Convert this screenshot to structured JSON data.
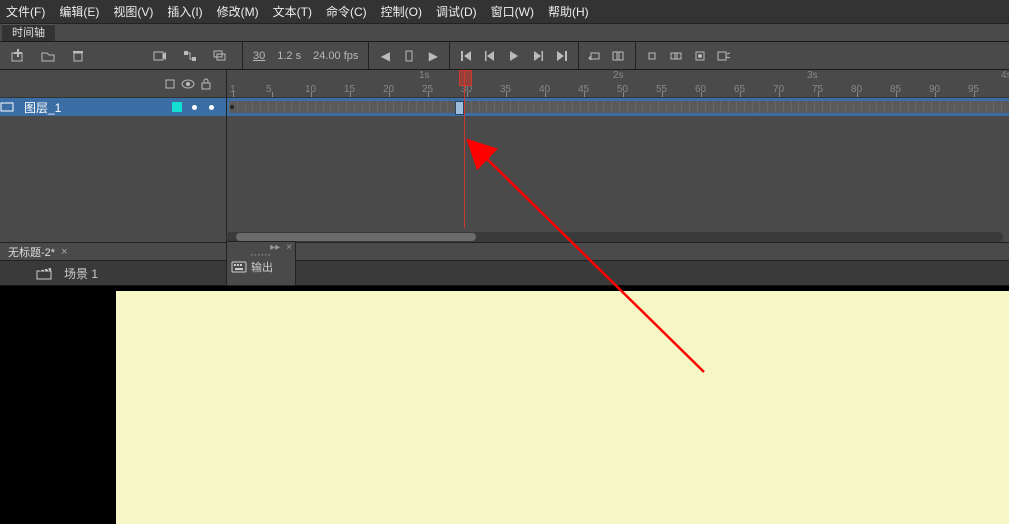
{
  "menu": [
    "文件(F)",
    "编辑(E)",
    "视图(V)",
    "插入(I)",
    "修改(M)",
    "文本(T)",
    "命令(C)",
    "控制(O)",
    "调试(D)",
    "窗口(W)",
    "帮助(H)"
  ],
  "panel_tab": "时间轴",
  "toolbar": {
    "frame_label": "30",
    "time_label": "1.2 s",
    "fps_label": "24.00 fps"
  },
  "ruler": {
    "seconds": [
      "1s",
      "2s",
      "3s",
      "4s"
    ],
    "frames": [
      "1",
      "5",
      "10",
      "15",
      "20",
      "25",
      "30",
      "35",
      "40",
      "45",
      "50",
      "55",
      "60",
      "65",
      "70",
      "75",
      "80",
      "85",
      "90",
      "95"
    ]
  },
  "layer": {
    "name": "图层_1"
  },
  "doc_tab": "无标题-2*",
  "output_panel": "输出",
  "scene": "场景 1",
  "playhead_frame": 30
}
